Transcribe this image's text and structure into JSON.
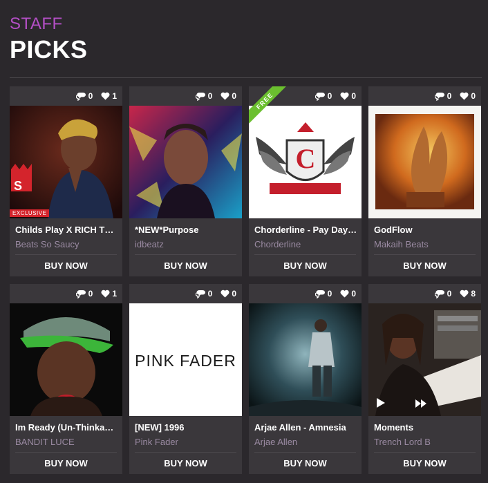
{
  "header": {
    "line1": "STAFF",
    "line2": "PICKS"
  },
  "accent": "#b44fc6",
  "free_ribbon": "FREE",
  "exclusive_badge": "EXCLUSIVE",
  "pink_fader_logo": "PINK FADER",
  "cards": [
    {
      "title": "Childs Play X RICH THE KID Type Beat",
      "author": "Beats So Saucy",
      "comments": "0",
      "likes": "1",
      "buy": "BUY NOW"
    },
    {
      "title": "*NEW*Purpose",
      "author": "idbeatz",
      "comments": "0",
      "likes": "0",
      "buy": "BUY NOW"
    },
    {
      "title": "Chorderline - Pay Day (Prod.)",
      "author": "Chorderline",
      "comments": "0",
      "likes": "0",
      "buy": "BUY NOW"
    },
    {
      "title": "GodFlow",
      "author": "Makaih Beats",
      "comments": "0",
      "likes": "0",
      "buy": "BUY NOW"
    },
    {
      "title": "Im Ready (Un-Thinkable)",
      "author": "BANDIT LUCE",
      "comments": "0",
      "likes": "1",
      "buy": "BUY NOW"
    },
    {
      "title": "[NEW] 1996",
      "author": "Pink Fader",
      "comments": "0",
      "likes": "0",
      "buy": "BUY NOW"
    },
    {
      "title": "Arjae Allen - Amnesia",
      "author": "Arjae Allen",
      "comments": "0",
      "likes": "0",
      "buy": "BUY NOW"
    },
    {
      "title": "Moments",
      "author": "Trench Lord B",
      "comments": "0",
      "likes": "8",
      "buy": "BUY NOW"
    }
  ]
}
